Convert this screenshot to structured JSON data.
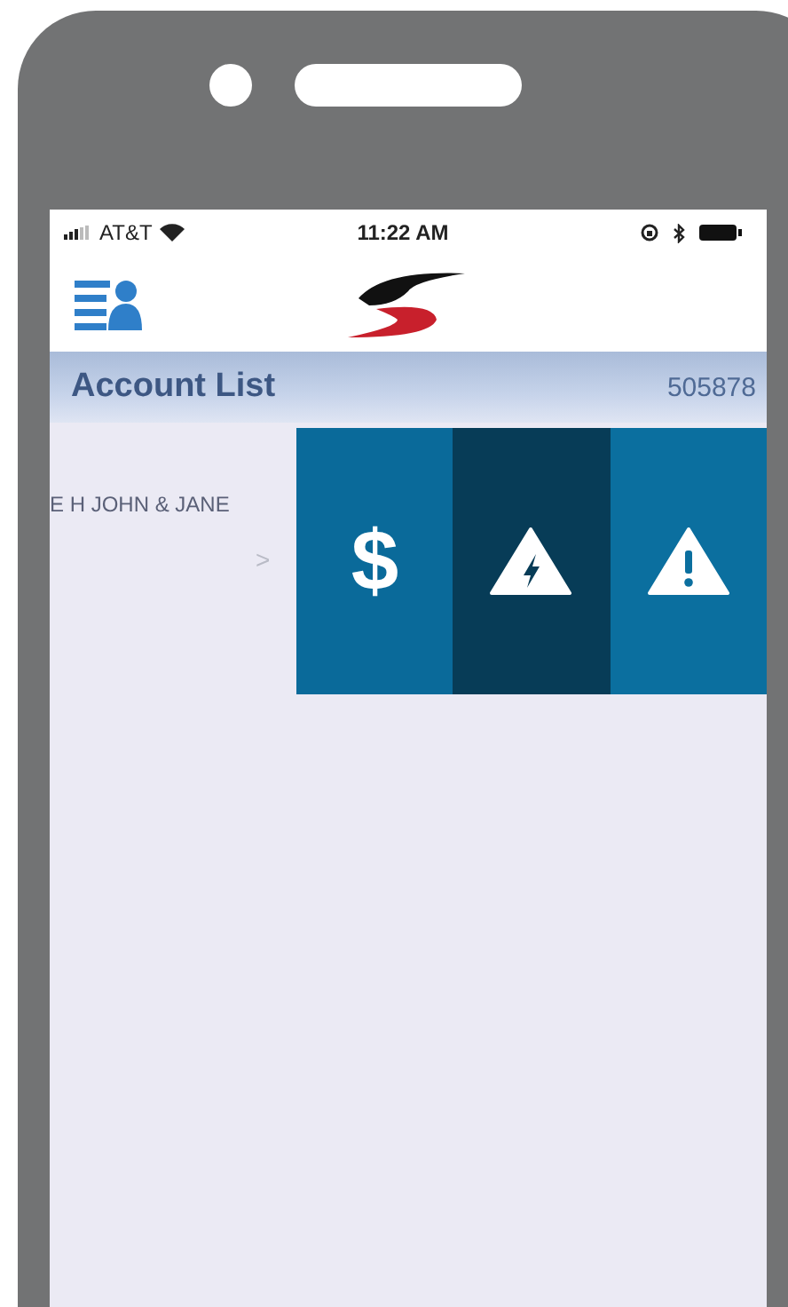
{
  "status_bar": {
    "carrier": "AT&T",
    "time": "11:22 AM"
  },
  "header": {
    "title": "Account List",
    "number": "505878"
  },
  "accounts": [
    {
      "name": "E H JOHN & JANE",
      "chevron": ">",
      "actions": [
        {
          "kind": "dollar",
          "symbol": "$"
        },
        {
          "kind": "outage"
        },
        {
          "kind": "alert"
        }
      ]
    }
  ]
}
